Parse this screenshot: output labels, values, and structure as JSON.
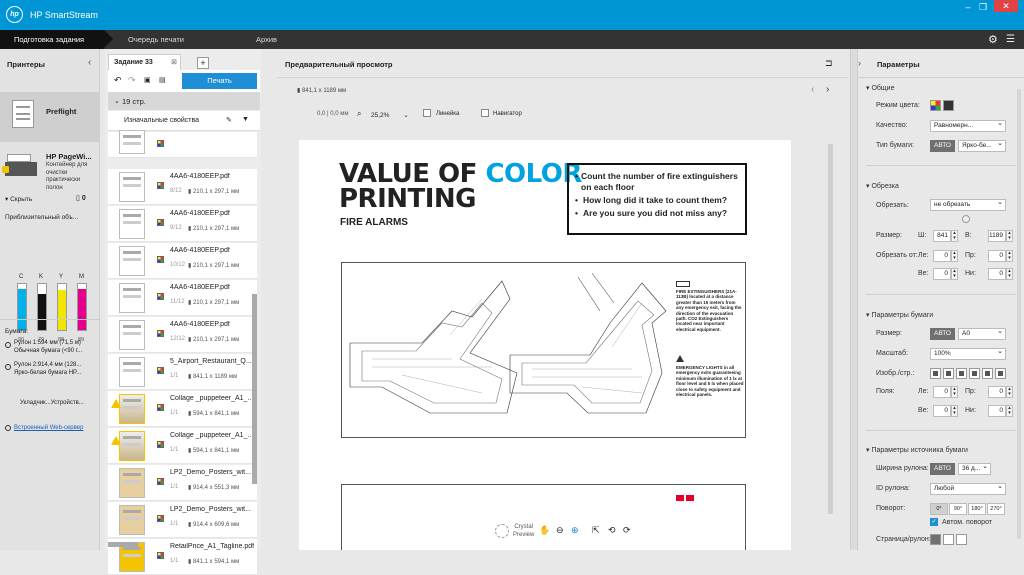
{
  "app": {
    "title": "HP SmartStream"
  },
  "tabs": [
    "Подготовка задания",
    "Очередь печати",
    "Архив"
  ],
  "printers": {
    "title": "Принтеры",
    "preflight": "Preflight",
    "printer_name": "HP PageWi...",
    "printer_desc": [
      "Контейнер для",
      "очистки",
      "практически",
      "полон"
    ],
    "hide": "Скрыть",
    "count": "0",
    "ink_title": "Приблизительный объ...",
    "inks": [
      {
        "letter": "C",
        "color": "#00b0e8",
        "level": 90,
        "value": "90"
      },
      {
        "letter": "K",
        "color": "#111111",
        "level": 79,
        "value": "79"
      },
      {
        "letter": "Y",
        "color": "#f2e600",
        "level": 88,
        "value": "88"
      },
      {
        "letter": "M",
        "color": "#e4008c",
        "level": 89,
        "value": "89"
      }
    ],
    "paper_title": "Бумага:",
    "rolls": [
      {
        "line1": "Рулон 1:594 мм (71,5 м)",
        "line2": "Обычная бумага (<90 г..."
      },
      {
        "line1": "Рулон 2:914,4 мм (128...",
        "line2": "Ярко-белая бумага HP..."
      }
    ],
    "settings": "Укладчик...",
    "devices": "Устройств...",
    "web_server": "Встроенный Web-сервер"
  },
  "job": {
    "tab": "Задание 33",
    "print_button": "Печать",
    "pages": "19 стр.",
    "orig_props": "Изначальные свойства",
    "rows": [
      {
        "name": "",
        "count": "",
        "size": "",
        "warn": false
      },
      {
        "name": "4AA6-4180EEP.pdf",
        "count": "8/12",
        "size": "210,1 x 297,1 мм",
        "warn": false
      },
      {
        "name": "4AA6-4180EEP.pdf",
        "count": "9/12",
        "size": "210,1 x 297,1 мм",
        "warn": false
      },
      {
        "name": "4AA6-4180EEP.pdf",
        "count": "10/12",
        "size": "210,1 x 297,1 мм",
        "warn": false
      },
      {
        "name": "4AA6-4180EEP.pdf",
        "count": "11/12",
        "size": "210,1 x 297,1 мм",
        "warn": false
      },
      {
        "name": "4AA6-4180EEP.pdf",
        "count": "12/12",
        "size": "210,1 x 297,1 мм",
        "warn": false
      },
      {
        "name": "5_Airport_Restaurant_Q...",
        "count": "1/1",
        "size": "841,1 x 1189 мм",
        "warn": false
      },
      {
        "name": "Collage _puppeteer_A1_...",
        "count": "1/1",
        "size": "594,1 x 841,1 мм",
        "warn": true
      },
      {
        "name": "Collage _puppeteer_A1_...",
        "count": "1/1",
        "size": "594,1 x 841,1 мм",
        "warn": true
      },
      {
        "name": "LP2_Demo_Posters_wit...",
        "count": "1/1",
        "size": "914,4 x 551,3 мм",
        "warn": false
      },
      {
        "name": "LP2_Demo_Posters_wit...",
        "count": "1/1",
        "size": "914,4 x 609,6 мм",
        "warn": false
      },
      {
        "name": "RetailPrice_A1_Tagline.pdf",
        "count": "1/1",
        "size": "841,1 x 594,1 мм",
        "warn": false
      }
    ]
  },
  "preview": {
    "title": "Предварительный просмотр",
    "page_size": "841,1 x 1189 мм",
    "coords": "0,0 | 0,0 мм",
    "zoom": "25,2%",
    "ruler": "Линейка",
    "navigator": "Навигатор",
    "crystal": "Crystal",
    "crystal2": "Preview",
    "doc": {
      "title1a": "VALUE OF ",
      "title1b": "COLOR",
      "title2": "PRINTING",
      "subtitle": "FIRE ALARMS",
      "bullets": [
        "Count the number of fire extinguishers on each floor",
        "How long did it take to count them?",
        "Are you sure you did not miss any?"
      ],
      "note1": "FIRE EXTINGUISHERS (21A-113B) located at a distance greater than 15 meters from any emergency exit, facing the direction of the evacuation path. CO2 Extinguishers located near important electrical equipment.",
      "note2": "EMERGENCY LIGHTS in all emergency exits guaranteeing minimum illumination of 1 lx at floor level and 5 lx when placed close to safety equipment and electrical panels."
    }
  },
  "params": {
    "title": "Параметры",
    "general": {
      "title": "Общие",
      "color_mode": "Режим цвета:",
      "quality": "Качество:",
      "quality_val": "Равномерн...",
      "paper_type": "Тип бумаги:",
      "auto": "АВТО",
      "paper_type_val": "Ярко-бе..."
    },
    "crop": {
      "title": "Обрезка",
      "crop": "Обрезать:",
      "crop_val": "не обрезать",
      "size": "Размер:",
      "w": "Ш:",
      "w_val": "841",
      "h": "В:",
      "h_val": "1189",
      "cut_from": "Обрезать от:",
      "le": "Ле:",
      "le_val": "0",
      "pr": "Пр:",
      "pr_val": "0",
      "ve": "Ве:",
      "ve_val": "0",
      "ni": "Ни:",
      "ni_val": "0"
    },
    "paper": {
      "title": "Параметры бумаги",
      "size": "Размер:",
      "auto": "АВТО",
      "size_val": "A0",
      "scale": "Масштаб:",
      "scale_val": "100%",
      "img_page": "Изобр./стр.:",
      "margins": "Поля:",
      "le": "Ле:",
      "le_val": "0",
      "pr": "Пр:",
      "pr_val": "0",
      "ve": "Ве:",
      "ve_val": "0",
      "ni": "Ни:",
      "ni_val": "0"
    },
    "source": {
      "title": "Параметры источника бумаги",
      "roll_width": "Ширина рулона:",
      "auto": "АВТО",
      "roll_width_val": "36 д...",
      "roll_id": "ID рулона:",
      "roll_id_val": "Любой",
      "rotate": "Поворот:",
      "rot": [
        "0°",
        "90°",
        "180°",
        "270°"
      ],
      "auto_rotate": "Автом. поворот",
      "page_roll": "Страница/рулон:"
    }
  }
}
